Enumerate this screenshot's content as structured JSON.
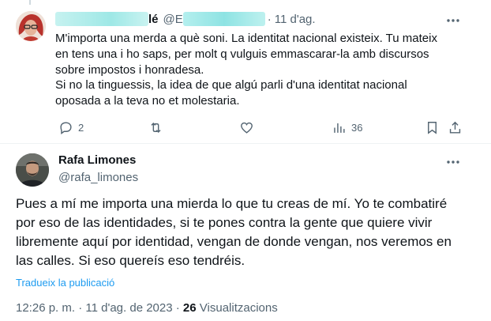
{
  "reply": {
    "name_suffix": "lé",
    "handle_prefix": "@E",
    "separator": "·",
    "date": "11 d'ag.",
    "text_lines": [
      "M'importa una merda a què soni. La identitat nacional existeix. Tu mateix",
      "en tens una i ho saps, per molt q vulguis emmascarar-la amb discursos",
      "sobre impostos i honradesa.",
      "Si no la tinguessis, la idea de que algú parli d'una identitat nacional",
      "oposada a la teva no et molestaria."
    ],
    "actions": {
      "reply_count": "2",
      "retweet_count": "",
      "like_count": "",
      "views_count": "36"
    },
    "icons": [
      "reply-icon",
      "retweet-icon",
      "like-icon",
      "views-icon",
      "bookmark-icon",
      "share-icon",
      "more-icon"
    ]
  },
  "main": {
    "name": "Rafa Limones",
    "handle": "@rafa_limones",
    "text_lines": [
      "Pues a mí me importa una mierda lo que tu creas de mí. Yo te combatiré",
      "por eso de las identidades, si te pones contra la gente que quiere vivir",
      "libremente aquí por identidad, vengan de donde vengan, nos veremos en",
      "las calles. Si eso quereís eso tendréis."
    ],
    "translate_link": "Tradueix la publicació",
    "time": "12:26 p. m.",
    "separator": "·",
    "date": "11 d'ag. de 2023",
    "views_count": "26",
    "views_label": "Visualitzacions"
  },
  "colors": {
    "text": "#0f1419",
    "secondary": "#536471",
    "link": "#1d9bf0",
    "border": "#eff3f4"
  }
}
